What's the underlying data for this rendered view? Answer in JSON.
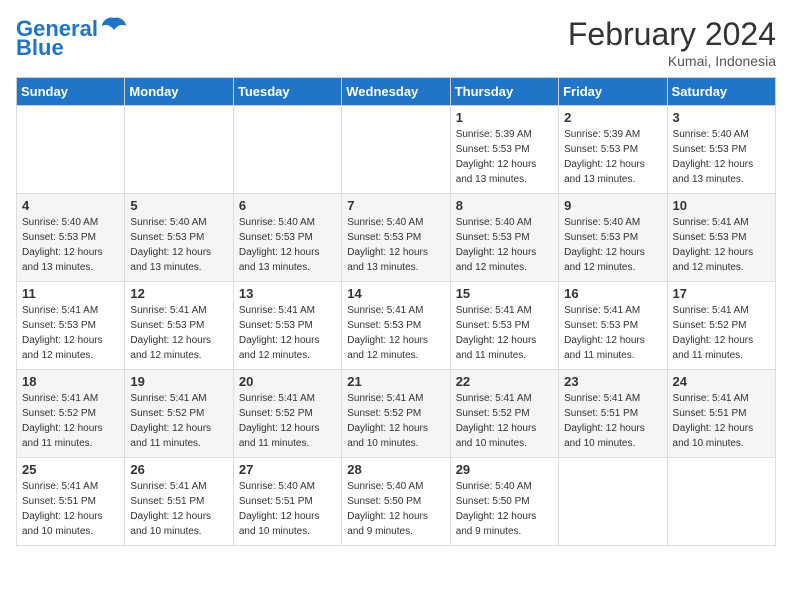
{
  "logo": {
    "line1": "General",
    "line2": "Blue"
  },
  "title": "February 2024",
  "subtitle": "Kumai, Indonesia",
  "days_of_week": [
    "Sunday",
    "Monday",
    "Tuesday",
    "Wednesday",
    "Thursday",
    "Friday",
    "Saturday"
  ],
  "weeks": [
    [
      {
        "day": "",
        "info": ""
      },
      {
        "day": "",
        "info": ""
      },
      {
        "day": "",
        "info": ""
      },
      {
        "day": "",
        "info": ""
      },
      {
        "day": "1",
        "info": "Sunrise: 5:39 AM\nSunset: 5:53 PM\nDaylight: 12 hours\nand 13 minutes."
      },
      {
        "day": "2",
        "info": "Sunrise: 5:39 AM\nSunset: 5:53 PM\nDaylight: 12 hours\nand 13 minutes."
      },
      {
        "day": "3",
        "info": "Sunrise: 5:40 AM\nSunset: 5:53 PM\nDaylight: 12 hours\nand 13 minutes."
      }
    ],
    [
      {
        "day": "4",
        "info": "Sunrise: 5:40 AM\nSunset: 5:53 PM\nDaylight: 12 hours\nand 13 minutes."
      },
      {
        "day": "5",
        "info": "Sunrise: 5:40 AM\nSunset: 5:53 PM\nDaylight: 12 hours\nand 13 minutes."
      },
      {
        "day": "6",
        "info": "Sunrise: 5:40 AM\nSunset: 5:53 PM\nDaylight: 12 hours\nand 13 minutes."
      },
      {
        "day": "7",
        "info": "Sunrise: 5:40 AM\nSunset: 5:53 PM\nDaylight: 12 hours\nand 13 minutes."
      },
      {
        "day": "8",
        "info": "Sunrise: 5:40 AM\nSunset: 5:53 PM\nDaylight: 12 hours\nand 12 minutes."
      },
      {
        "day": "9",
        "info": "Sunrise: 5:40 AM\nSunset: 5:53 PM\nDaylight: 12 hours\nand 12 minutes."
      },
      {
        "day": "10",
        "info": "Sunrise: 5:41 AM\nSunset: 5:53 PM\nDaylight: 12 hours\nand 12 minutes."
      }
    ],
    [
      {
        "day": "11",
        "info": "Sunrise: 5:41 AM\nSunset: 5:53 PM\nDaylight: 12 hours\nand 12 minutes."
      },
      {
        "day": "12",
        "info": "Sunrise: 5:41 AM\nSunset: 5:53 PM\nDaylight: 12 hours\nand 12 minutes."
      },
      {
        "day": "13",
        "info": "Sunrise: 5:41 AM\nSunset: 5:53 PM\nDaylight: 12 hours\nand 12 minutes."
      },
      {
        "day": "14",
        "info": "Sunrise: 5:41 AM\nSunset: 5:53 PM\nDaylight: 12 hours\nand 12 minutes."
      },
      {
        "day": "15",
        "info": "Sunrise: 5:41 AM\nSunset: 5:53 PM\nDaylight: 12 hours\nand 11 minutes."
      },
      {
        "day": "16",
        "info": "Sunrise: 5:41 AM\nSunset: 5:53 PM\nDaylight: 12 hours\nand 11 minutes."
      },
      {
        "day": "17",
        "info": "Sunrise: 5:41 AM\nSunset: 5:52 PM\nDaylight: 12 hours\nand 11 minutes."
      }
    ],
    [
      {
        "day": "18",
        "info": "Sunrise: 5:41 AM\nSunset: 5:52 PM\nDaylight: 12 hours\nand 11 minutes."
      },
      {
        "day": "19",
        "info": "Sunrise: 5:41 AM\nSunset: 5:52 PM\nDaylight: 12 hours\nand 11 minutes."
      },
      {
        "day": "20",
        "info": "Sunrise: 5:41 AM\nSunset: 5:52 PM\nDaylight: 12 hours\nand 11 minutes."
      },
      {
        "day": "21",
        "info": "Sunrise: 5:41 AM\nSunset: 5:52 PM\nDaylight: 12 hours\nand 10 minutes."
      },
      {
        "day": "22",
        "info": "Sunrise: 5:41 AM\nSunset: 5:52 PM\nDaylight: 12 hours\nand 10 minutes."
      },
      {
        "day": "23",
        "info": "Sunrise: 5:41 AM\nSunset: 5:51 PM\nDaylight: 12 hours\nand 10 minutes."
      },
      {
        "day": "24",
        "info": "Sunrise: 5:41 AM\nSunset: 5:51 PM\nDaylight: 12 hours\nand 10 minutes."
      }
    ],
    [
      {
        "day": "25",
        "info": "Sunrise: 5:41 AM\nSunset: 5:51 PM\nDaylight: 12 hours\nand 10 minutes."
      },
      {
        "day": "26",
        "info": "Sunrise: 5:41 AM\nSunset: 5:51 PM\nDaylight: 12 hours\nand 10 minutes."
      },
      {
        "day": "27",
        "info": "Sunrise: 5:40 AM\nSunset: 5:51 PM\nDaylight: 12 hours\nand 10 minutes."
      },
      {
        "day": "28",
        "info": "Sunrise: 5:40 AM\nSunset: 5:50 PM\nDaylight: 12 hours\nand 9 minutes."
      },
      {
        "day": "29",
        "info": "Sunrise: 5:40 AM\nSunset: 5:50 PM\nDaylight: 12 hours\nand 9 minutes."
      },
      {
        "day": "",
        "info": ""
      },
      {
        "day": "",
        "info": ""
      }
    ]
  ]
}
